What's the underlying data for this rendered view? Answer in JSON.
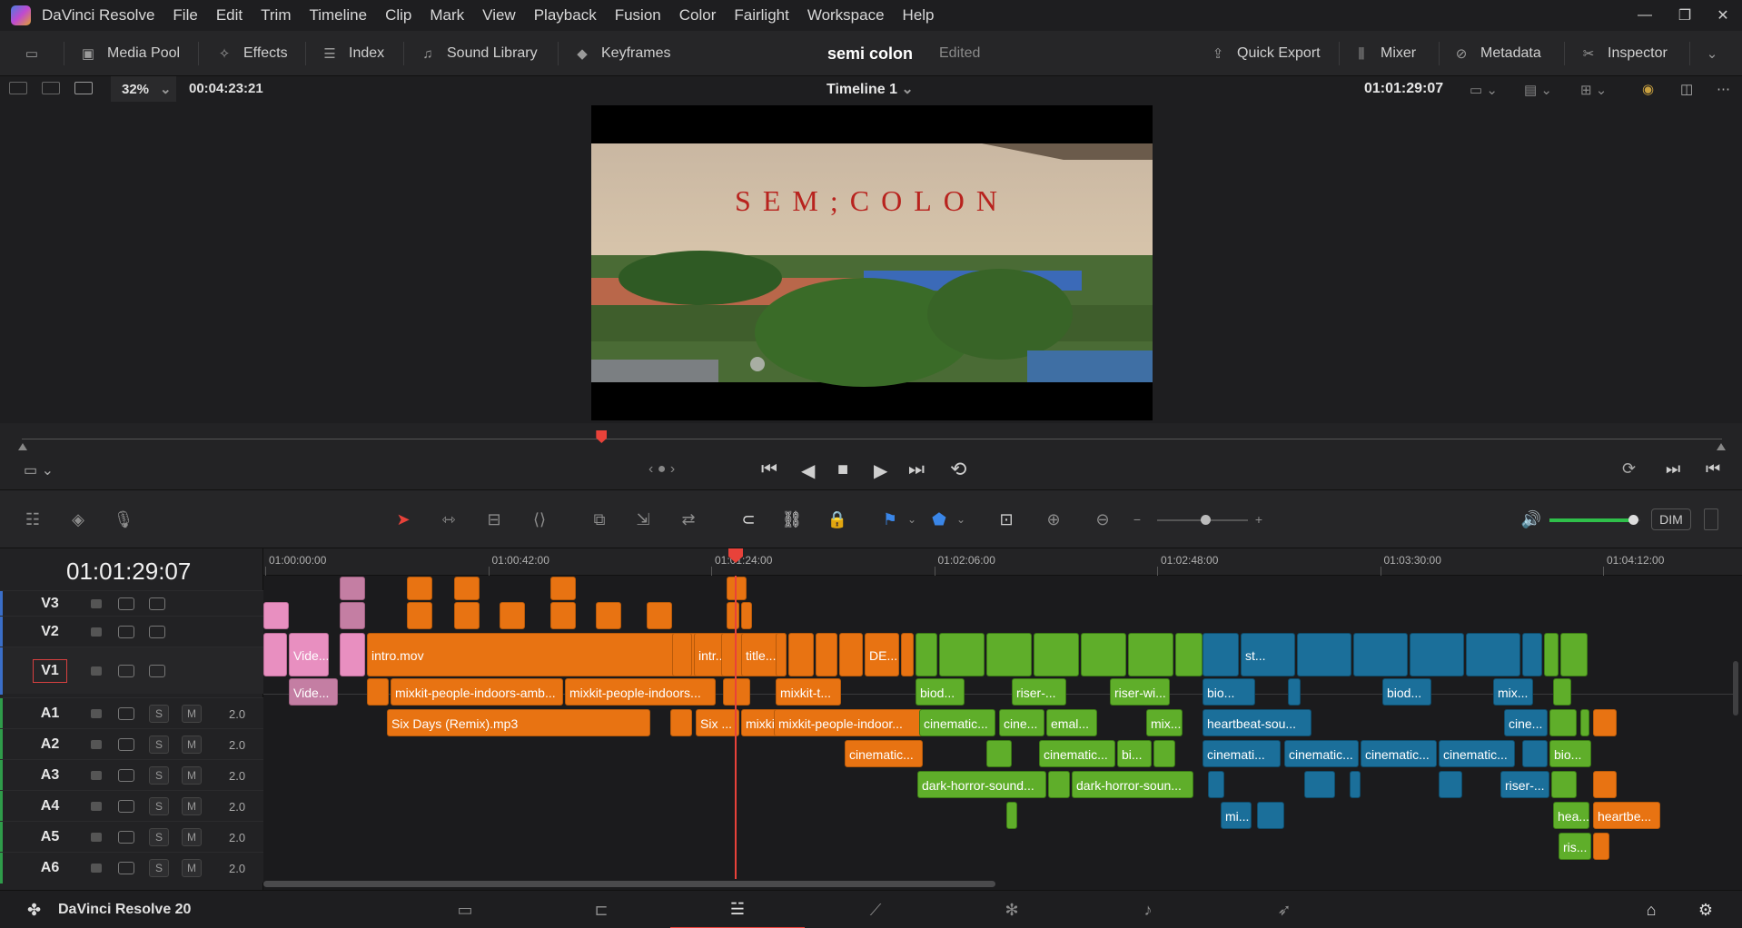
{
  "app": {
    "name": "DaVinci Resolve",
    "menu": [
      "File",
      "Edit",
      "Trim",
      "Timeline",
      "Clip",
      "Mark",
      "View",
      "Playback",
      "Fusion",
      "Color",
      "Fairlight",
      "Workspace",
      "Help"
    ],
    "window_controls": {
      "minimize": "—",
      "restore": "❐",
      "close": "✕"
    }
  },
  "toolbar": {
    "media_pool": "Media Pool",
    "effects": "Effects",
    "index": "Index",
    "sound_library": "Sound Library",
    "keyframes": "Keyframes",
    "project_title": "semi colon",
    "project_status": "Edited",
    "quick_export": "Quick Export",
    "mixer": "Mixer",
    "metadata": "Metadata",
    "inspector": "Inspector"
  },
  "viewer": {
    "zoom": "32%",
    "duration": "00:04:23:21",
    "timeline_name": "Timeline 1",
    "timecode": "01:01:29:07",
    "overlay_title": "SEM;COLON",
    "playhead_position": 0.341
  },
  "timeline": {
    "current_timecode": "01:01:29:07",
    "ruler_ticks": [
      "01:00:00:00",
      "01:00:42:00",
      "01:01:24:00",
      "01:02:06:00",
      "01:02:48:00",
      "01:03:30:00",
      "01:04:12:00"
    ],
    "video_tracks": [
      "V3",
      "V2",
      "V1"
    ],
    "audio_tracks": [
      {
        "name": "A1",
        "solo": "S",
        "mute": "M",
        "level": "2.0"
      },
      {
        "name": "A2",
        "solo": "S",
        "mute": "M",
        "level": "2.0"
      },
      {
        "name": "A3",
        "solo": "S",
        "mute": "M",
        "level": "2.0"
      },
      {
        "name": "A4",
        "solo": "S",
        "mute": "M",
        "level": "2.0"
      },
      {
        "name": "A5",
        "solo": "S",
        "mute": "M",
        "level": "2.0"
      },
      {
        "name": "A6",
        "solo": "S",
        "mute": "M",
        "level": "2.0"
      }
    ],
    "clip_labels": {
      "v1_vide": "Vide...",
      "v1_intro": "intro.mov",
      "v1_intr": "intr...",
      "v1_title": "title....",
      "v1_de": "DE...",
      "v1_st": "st...",
      "a1_vide": "Vide...",
      "a1_amb1": "mixkit-people-indoors-amb...",
      "a1_amb2": "mixkit-people-indoors...",
      "a1_mixt": "mixkit-t...",
      "a1_biod": "biod...",
      "a1_riser": "riser-...",
      "a1_riserwi": "riser-wi...",
      "a1_bio": "bio...",
      "a1_biod2": "biod...",
      "a1_mix": "mix...",
      "a2_six": "Six Days (Remix).mp3",
      "a2_six2": "Six ...",
      "a2_mixki": "mixki...",
      "a2_indoor": "mixkit-people-indoor...",
      "a2_cine1": "cinematic...",
      "a2_cine2": "cine...",
      "a2_emal": "emal...",
      "a2_mix": "mix...",
      "a2_heart": "heartbeat-sou...",
      "a2_cine3": "cine...",
      "a3_cine1": "cinematic...",
      "a3_cine2": "cinematic...",
      "a3_bi": "bi...",
      "a3_cine3": "cinemati...",
      "a3_cine4": "cinematic...",
      "a3_cine5": "cinematic...",
      "a3_cine6": "cinematic...",
      "a3_bio": "bio...",
      "a4_dark1": "dark-horror-sound...",
      "a4_dark2": "dark-horror-soun...",
      "a4_riser": "riser-...",
      "a5_mi": "mi...",
      "a5_hea": "hea...",
      "a5_heartbe": "heartbe...",
      "a6_ris": "ris..."
    }
  },
  "audio": {
    "dim": "DIM",
    "volume_fraction": 0.92
  },
  "status": {
    "app_version": "DaVinci Resolve 20",
    "active_page": "edit"
  },
  "colors": {
    "orange": "#e87312",
    "pink": "#e88fc0",
    "green": "#5fae2a",
    "blue": "#1b6f9a",
    "playhead": "#e8423a"
  }
}
